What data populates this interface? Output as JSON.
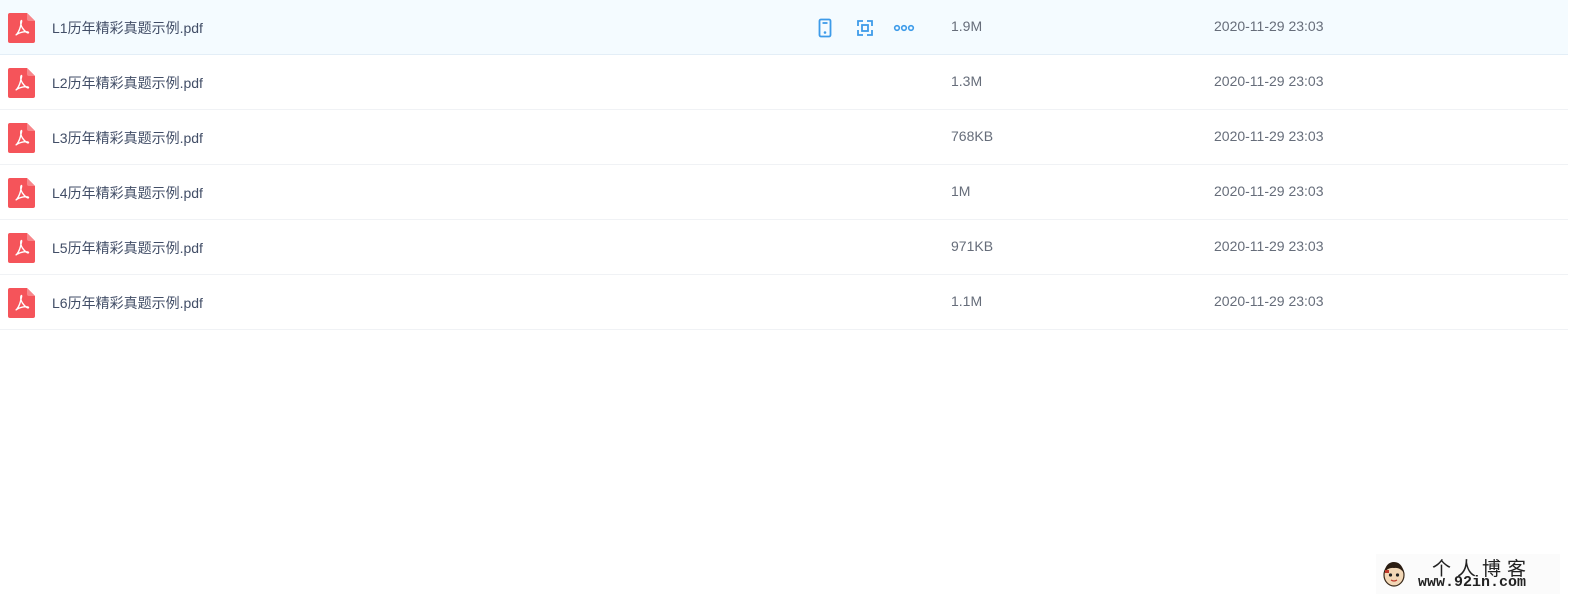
{
  "files": [
    {
      "name": "L1历年精彩真题示例.pdf",
      "size": "1.9M",
      "date": "2020-11-29 23:03",
      "icon": "pdf-icon"
    },
    {
      "name": "L2历年精彩真题示例.pdf",
      "size": "1.3M",
      "date": "2020-11-29 23:03",
      "icon": "pdf-icon"
    },
    {
      "name": "L3历年精彩真题示例.pdf",
      "size": "768KB",
      "date": "2020-11-29 23:03",
      "icon": "pdf-icon"
    },
    {
      "name": "L4历年精彩真题示例.pdf",
      "size": "1M",
      "date": "2020-11-29 23:03",
      "icon": "pdf-icon"
    },
    {
      "name": "L5历年精彩真题示例.pdf",
      "size": "971KB",
      "date": "2020-11-29 23:03",
      "icon": "pdf-icon"
    },
    {
      "name": "L6历年精彩真题示例.pdf",
      "size": "1.1M",
      "date": "2020-11-29 23:03",
      "icon": "pdf-icon"
    }
  ],
  "row_actions": [
    "phone-icon",
    "share-icon",
    "more-icon"
  ],
  "watermark": {
    "title": "个人博客",
    "url": "www.92in.com"
  },
  "colors": {
    "pdf_red": "#f5545a",
    "action_blue": "#3d9be9",
    "hover_bg": "#f4fbff",
    "text": "#424e67",
    "muted_text": "#666d7a"
  }
}
